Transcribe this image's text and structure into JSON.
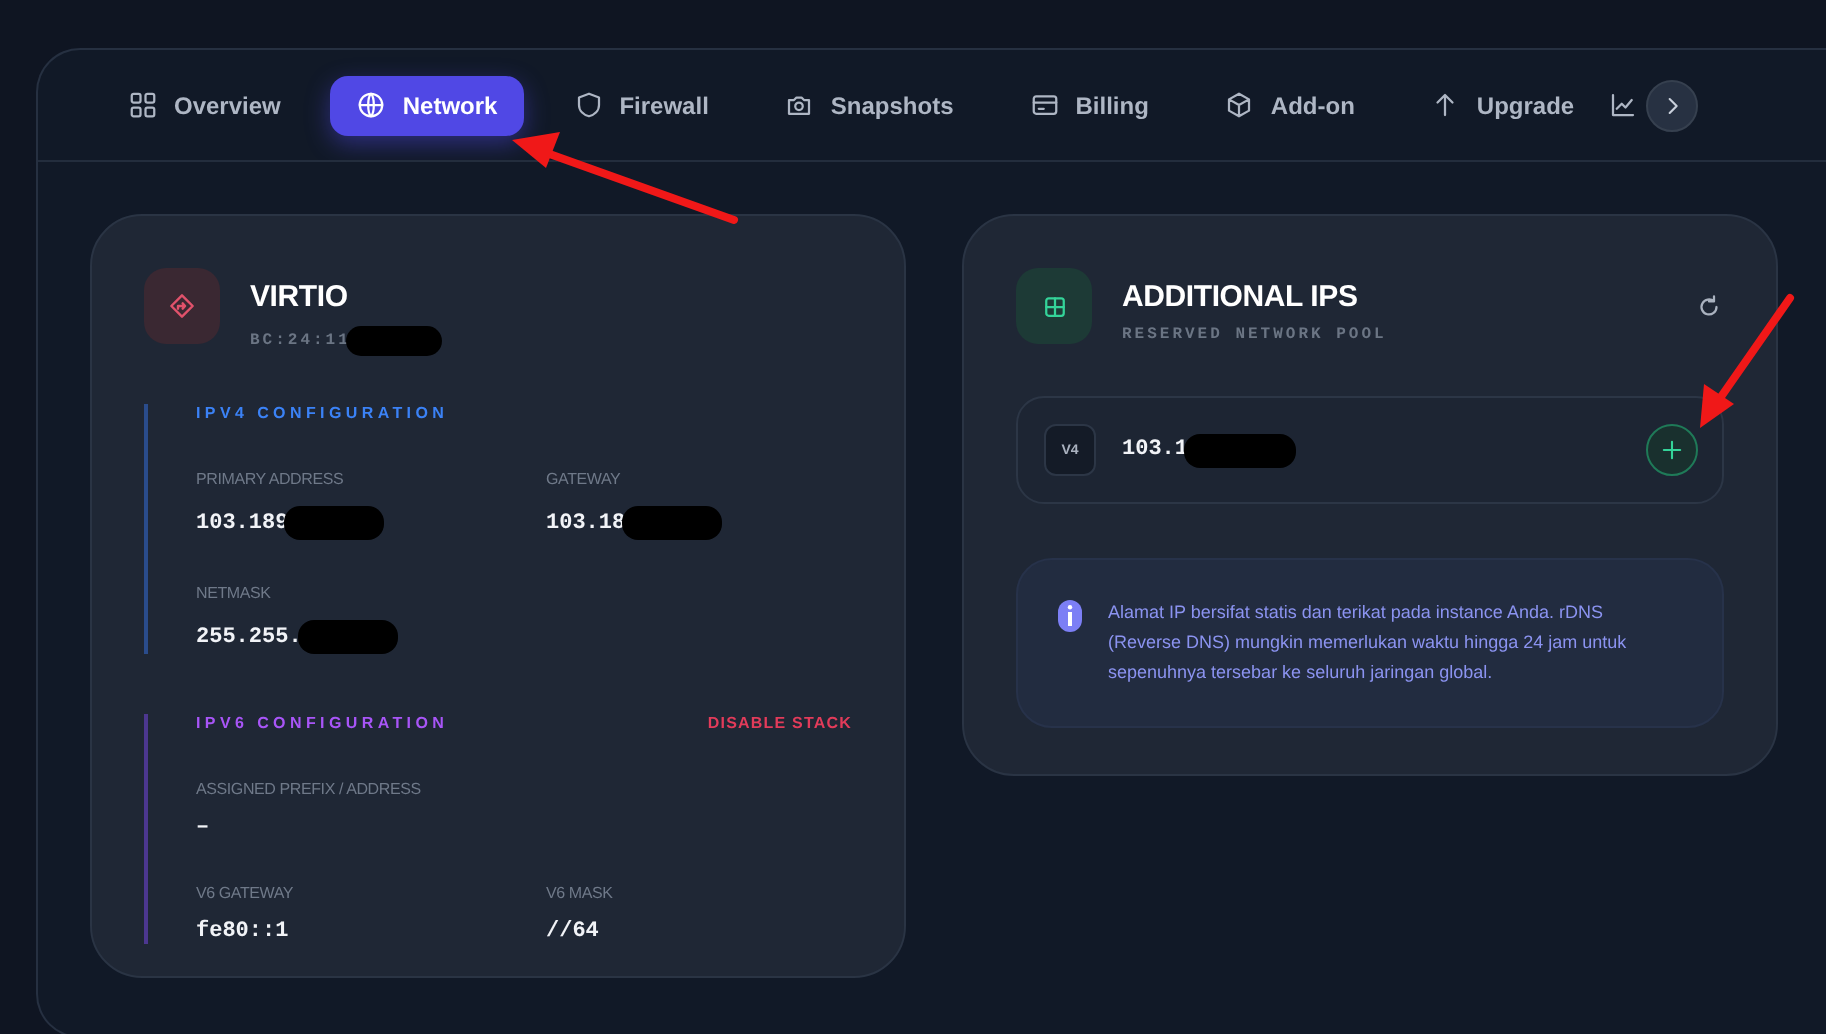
{
  "tabs": [
    {
      "label": "Overview",
      "selected": false
    },
    {
      "label": "Network",
      "selected": true
    },
    {
      "label": "Firewall",
      "selected": false
    },
    {
      "label": "Snapshots",
      "selected": false
    },
    {
      "label": "Billing",
      "selected": false
    },
    {
      "label": "Add-on",
      "selected": false
    },
    {
      "label": "Upgrade",
      "selected": false
    }
  ],
  "interface_card": {
    "title": "VIRTIO",
    "mac": {
      "value": "BC:24:11",
      "redacted": true
    },
    "sections": [
      {
        "title": "IPV4 CONFIGURATION",
        "kind": "ipv4",
        "rows": [
          [
            {
              "label": "PRIMARY ADDRESS",
              "value": "103.189",
              "redacted": true
            },
            {
              "label": "GATEWAY",
              "value": "103.18",
              "redacted": true
            }
          ],
          [
            {
              "label": "NETMASK",
              "value": "255.255.",
              "redacted": true
            }
          ]
        ]
      },
      {
        "title": "IPV6 CONFIGURATION",
        "kind": "ipv6",
        "action": "DISABLE STACK",
        "rows": [
          [
            {
              "label": "ASSIGNED PREFIX / ADDRESS",
              "value": "–"
            }
          ],
          [
            {
              "label": "V6 GATEWAY",
              "value": "fe80::1"
            },
            {
              "label": "V6 MASK",
              "value": "//64"
            }
          ]
        ]
      }
    ]
  },
  "ips_card": {
    "title": "ADDITIONAL IPS",
    "subtitle": "RESERVED NETWORK POOL",
    "ips": [
      {
        "version": "V4",
        "address": "103.1",
        "redacted": true
      }
    ],
    "info": "Alamat IP bersifat statis dan terikat pada instance Anda. rDNS (Reverse DNS) mungkin memerlukan waktu hingga 24 jam untuk sepenuhnya tersebar ke seluruh jaringan global."
  }
}
